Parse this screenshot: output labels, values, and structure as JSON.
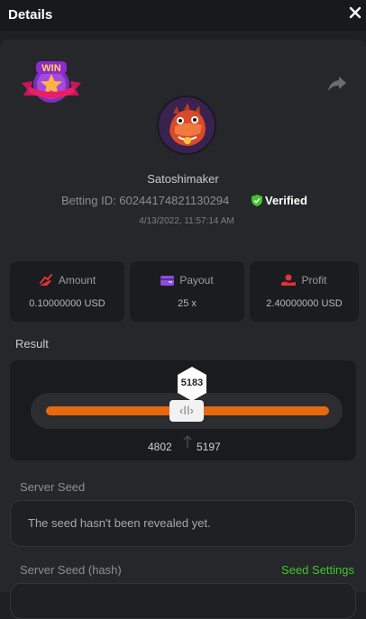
{
  "header": {
    "title": "Details"
  },
  "user": {
    "name": "Satoshimaker",
    "betting_id": "Betting ID: 60244174821130294",
    "verified_label": "Verified",
    "datetime": "4/13/2022, 11:57:14 AM"
  },
  "badge": {
    "text": "WIN"
  },
  "stats": [
    {
      "label": "Amount",
      "value": "0.10000000 USD",
      "icon": "amount-icon"
    },
    {
      "label": "Payout",
      "value": "25 x",
      "icon": "wallet-icon"
    },
    {
      "label": "Profit",
      "value": "2.40000000 USD",
      "icon": "profit-icon"
    }
  ],
  "result": {
    "label": "Result",
    "value": "5183",
    "range_low": "4802",
    "range_high": "5197"
  },
  "server_seed": {
    "label": "Server Seed",
    "text": "The seed hasn't been revealed yet."
  },
  "server_seed_hash": {
    "label": "Server Seed (hash)",
    "settings_link": "Seed Settings"
  },
  "colors": {
    "accent_orange": "#e8680f",
    "verified_green": "#3fc72c",
    "icon_red": "#e0323a",
    "icon_purple": "#8a4fe0"
  }
}
